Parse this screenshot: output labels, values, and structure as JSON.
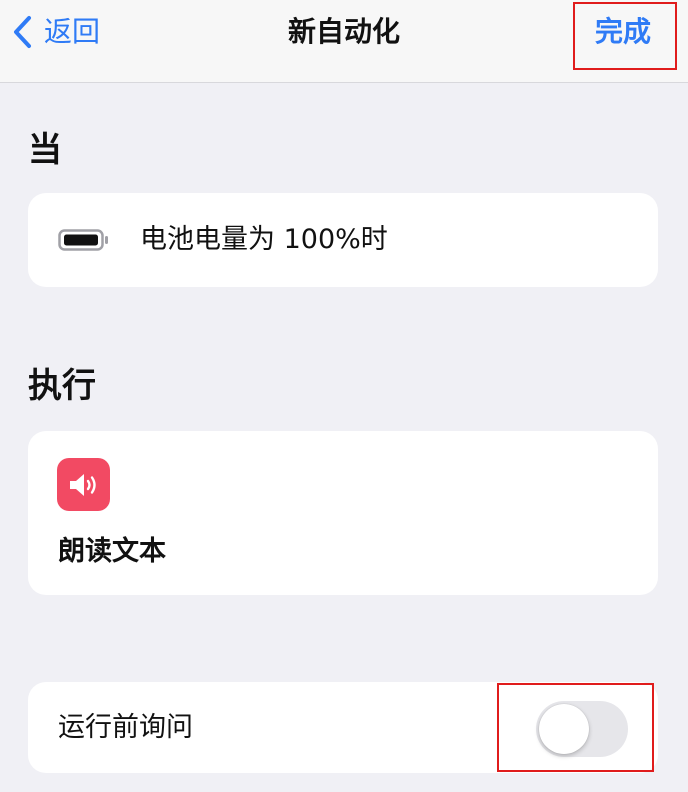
{
  "nav": {
    "back_label": "返回",
    "title": "新自动化",
    "done_label": "完成"
  },
  "when_section": {
    "title": "当",
    "trigger": {
      "icon": "battery-icon",
      "text": "电池电量为 100%时"
    }
  },
  "do_section": {
    "title": "执行",
    "action": {
      "icon": "speaker-icon",
      "text": "朗读文本"
    }
  },
  "ask_before_running": {
    "label": "运行前询问",
    "enabled": false
  },
  "colors": {
    "accent": "#2f7bf6",
    "action_icon_bg": "#f24a63",
    "highlight": "#e01c1c",
    "background": "#f0f0f5"
  }
}
